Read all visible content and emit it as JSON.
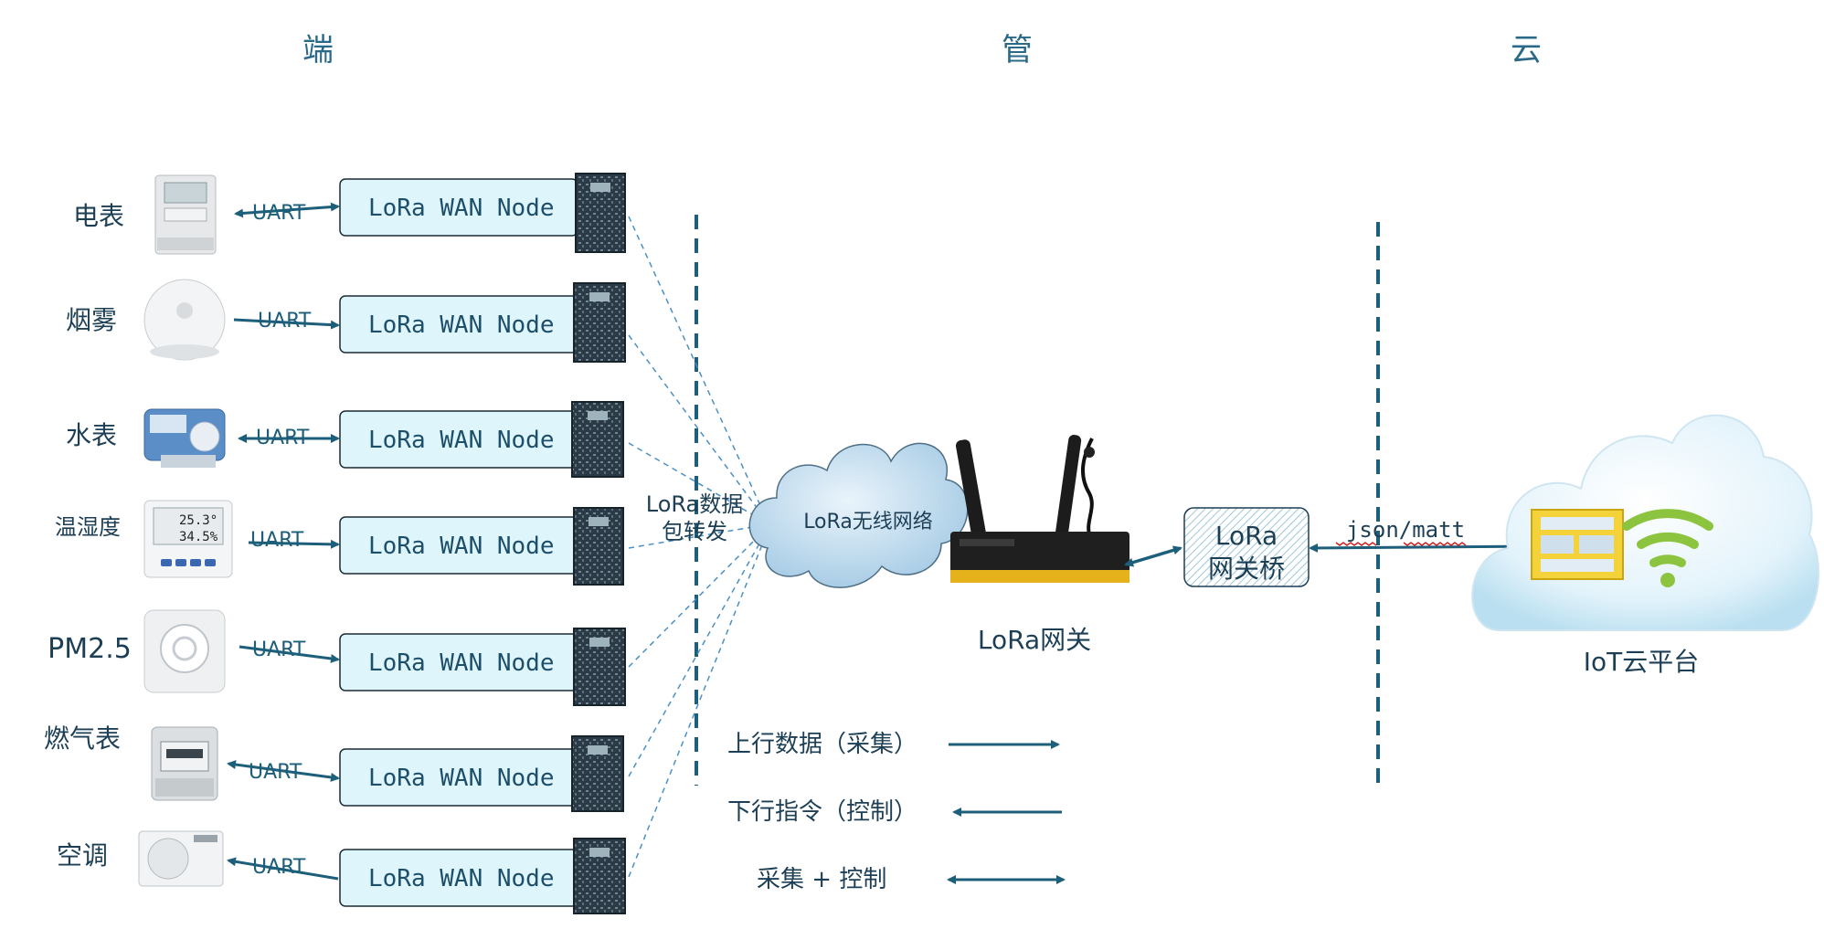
{
  "sections": [
    "端",
    "管",
    "云"
  ],
  "devices": [
    {
      "label": "电表",
      "interface": "UART",
      "node": "LoRa WAN Node"
    },
    {
      "label": "烟雾",
      "interface": "UART",
      "node": "LoRa WAN Node"
    },
    {
      "label": "水表",
      "interface": "UART",
      "node": "LoRa WAN Node"
    },
    {
      "label": "温湿度",
      "interface": "UART",
      "node": "LoRa WAN Node",
      "display": [
        "25.3°",
        "34.5%"
      ]
    },
    {
      "label": "PM2.5",
      "interface": "UART",
      "node": "LoRa WAN Node"
    },
    {
      "label": "燃气表",
      "interface": "UART",
      "node": "LoRa WAN Node"
    },
    {
      "label": "空调",
      "interface": "UART",
      "node": "LoRa WAN Node"
    }
  ],
  "forwarding_label": [
    "LoRa数据",
    "包转发"
  ],
  "wireless_cloud_label": "LoRa无线网络",
  "gateway_label": "LoRa网关",
  "bridge_label": [
    "LoRa",
    "网关桥"
  ],
  "protocol_label": "json/matt",
  "platform_label": "IoT云平台",
  "legend": [
    {
      "label": "上行数据（采集）",
      "direction": "right"
    },
    {
      "label": "下行指令（控制）",
      "direction": "left"
    },
    {
      "label": "采集 + 控制",
      "direction": "both"
    }
  ],
  "colors": {
    "line": "#1d5f7a",
    "node_fill": "#dff5fc",
    "section_text": "#2a6a88",
    "wave": "#9dc33b"
  }
}
